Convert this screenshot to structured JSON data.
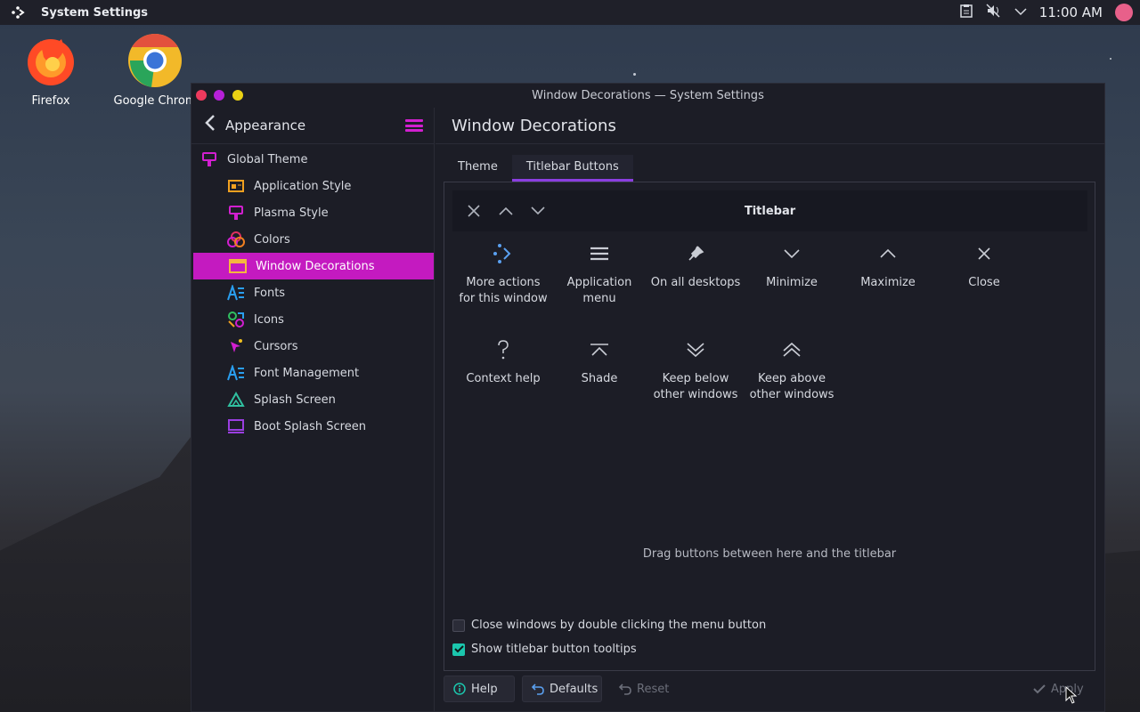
{
  "topbar": {
    "app_title": "System Settings",
    "clock": "11:00 AM"
  },
  "desktop": {
    "icons": [
      {
        "label": "Firefox"
      },
      {
        "label": "Google Chrom"
      }
    ]
  },
  "window": {
    "title": "Window Decorations — System Settings",
    "sidebar": {
      "header": "Appearance",
      "items": [
        {
          "label": "Global Theme"
        },
        {
          "label": "Application Style"
        },
        {
          "label": "Plasma Style"
        },
        {
          "label": "Colors"
        },
        {
          "label": "Window Decorations"
        },
        {
          "label": "Fonts"
        },
        {
          "label": "Icons"
        },
        {
          "label": "Cursors"
        },
        {
          "label": "Font Management"
        },
        {
          "label": "Splash Screen"
        },
        {
          "label": "Boot Splash Screen"
        }
      ]
    },
    "main": {
      "title": "Window Decorations",
      "tabs": [
        {
          "label": "Theme"
        },
        {
          "label": "Titlebar Buttons"
        }
      ],
      "preview_title": "Titlebar",
      "buttons": [
        {
          "line1": "More actions",
          "line2": "for this window"
        },
        {
          "line1": "Application",
          "line2": "menu"
        },
        {
          "line1": "On all desktops",
          "line2": ""
        },
        {
          "line1": "Minimize",
          "line2": ""
        },
        {
          "line1": "Maximize",
          "line2": ""
        },
        {
          "line1": "Close",
          "line2": ""
        },
        {
          "line1": "Context help",
          "line2": ""
        },
        {
          "line1": "Shade",
          "line2": ""
        },
        {
          "line1": "Keep below",
          "line2": "other windows"
        },
        {
          "line1": "Keep above",
          "line2": "other windows"
        }
      ],
      "hint": "Drag buttons between here and the titlebar",
      "checkboxes": [
        {
          "label": "Close windows by double clicking the menu button",
          "checked": false
        },
        {
          "label": "Show titlebar button tooltips",
          "checked": true
        }
      ],
      "footer": {
        "help": "Help",
        "defaults": "Defaults",
        "reset": "Reset",
        "apply": "Apply"
      }
    }
  },
  "colors": {
    "accent": "#c41ac0",
    "check": "#1bc6ad",
    "tab_underline": "#8b3ee0"
  }
}
